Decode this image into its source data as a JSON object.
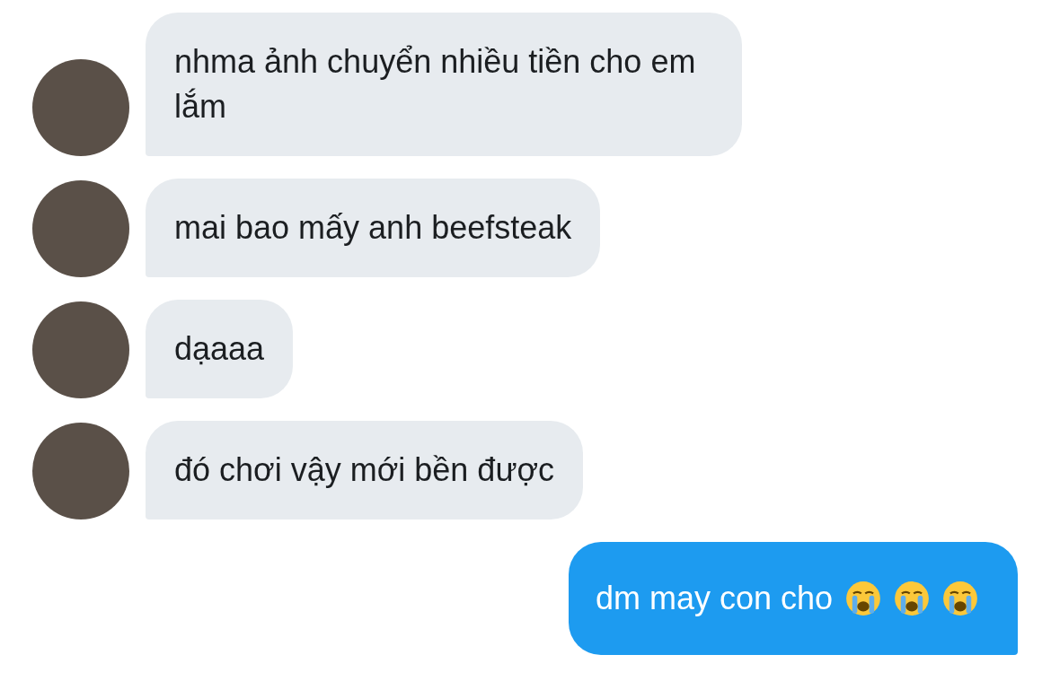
{
  "messages": [
    {
      "kind": "received",
      "text": "nhma ảnh chuyển nhiều tiền cho em lắm"
    },
    {
      "kind": "received",
      "text": "mai bao mấy anh beefsteak"
    },
    {
      "kind": "received",
      "text": "dạaaa"
    },
    {
      "kind": "received",
      "text": "đó chơi vậy mới bền được"
    },
    {
      "kind": "sent",
      "text": "dm may con cho",
      "emojis": [
        {
          "kind": "crying"
        },
        {
          "kind": "crying"
        },
        {
          "kind": "crying"
        }
      ]
    }
  ]
}
